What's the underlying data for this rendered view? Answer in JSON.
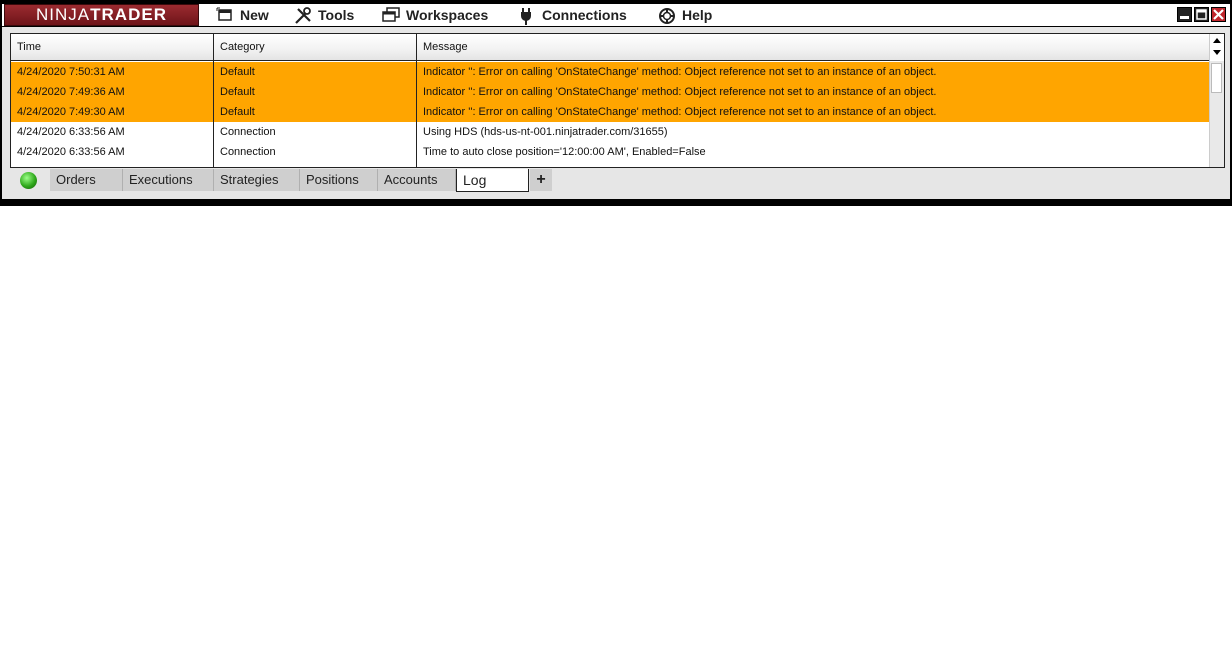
{
  "app": {
    "logo": {
      "part1": "NINJA",
      "part2": "TRADER"
    }
  },
  "menu": [
    {
      "label": "New",
      "icon": "new-window-icon"
    },
    {
      "label": "Tools",
      "icon": "tools-icon"
    },
    {
      "label": "Workspaces",
      "icon": "workspaces-icon"
    },
    {
      "label": "Connections",
      "icon": "plug-icon"
    },
    {
      "label": "Help",
      "icon": "help-ring-icon"
    }
  ],
  "window_controls": [
    "minimize-icon",
    "maximize-icon",
    "close-icon"
  ],
  "log": {
    "columns": [
      "Time",
      "Category",
      "Message"
    ],
    "rows": [
      {
        "time": "4/24/2020 7:50:31 AM",
        "category": "Default",
        "message": "Indicator '': Error on calling 'OnStateChange' method: Object reference not set to an instance of an object.",
        "level": "error"
      },
      {
        "time": "4/24/2020 7:49:36 AM",
        "category": "Default",
        "message": "Indicator '': Error on calling 'OnStateChange' method: Object reference not set to an instance of an object.",
        "level": "error"
      },
      {
        "time": "4/24/2020 7:49:30 AM",
        "category": "Default",
        "message": "Indicator '': Error on calling 'OnStateChange' method: Object reference not set to an instance of an object.",
        "level": "error"
      },
      {
        "time": "4/24/2020 6:33:56 AM",
        "category": "Connection",
        "message": "Using HDS (hds-us-nt-001.ninjatrader.com/31655)",
        "level": "info"
      },
      {
        "time": "4/24/2020 6:33:56 AM",
        "category": "Connection",
        "message": "Time to auto close position='12:00:00 AM', Enabled=False",
        "level": "info"
      }
    ]
  },
  "tabs": {
    "items": [
      "Orders",
      "Executions",
      "Strategies",
      "Positions",
      "Accounts",
      "Log"
    ],
    "active": "Log",
    "add_label": "+"
  },
  "colors": {
    "error_row": "#ffa500",
    "logo_bg": "#8b1e24",
    "close_button": "#c0262c",
    "status_connected": "#2fa81b"
  }
}
